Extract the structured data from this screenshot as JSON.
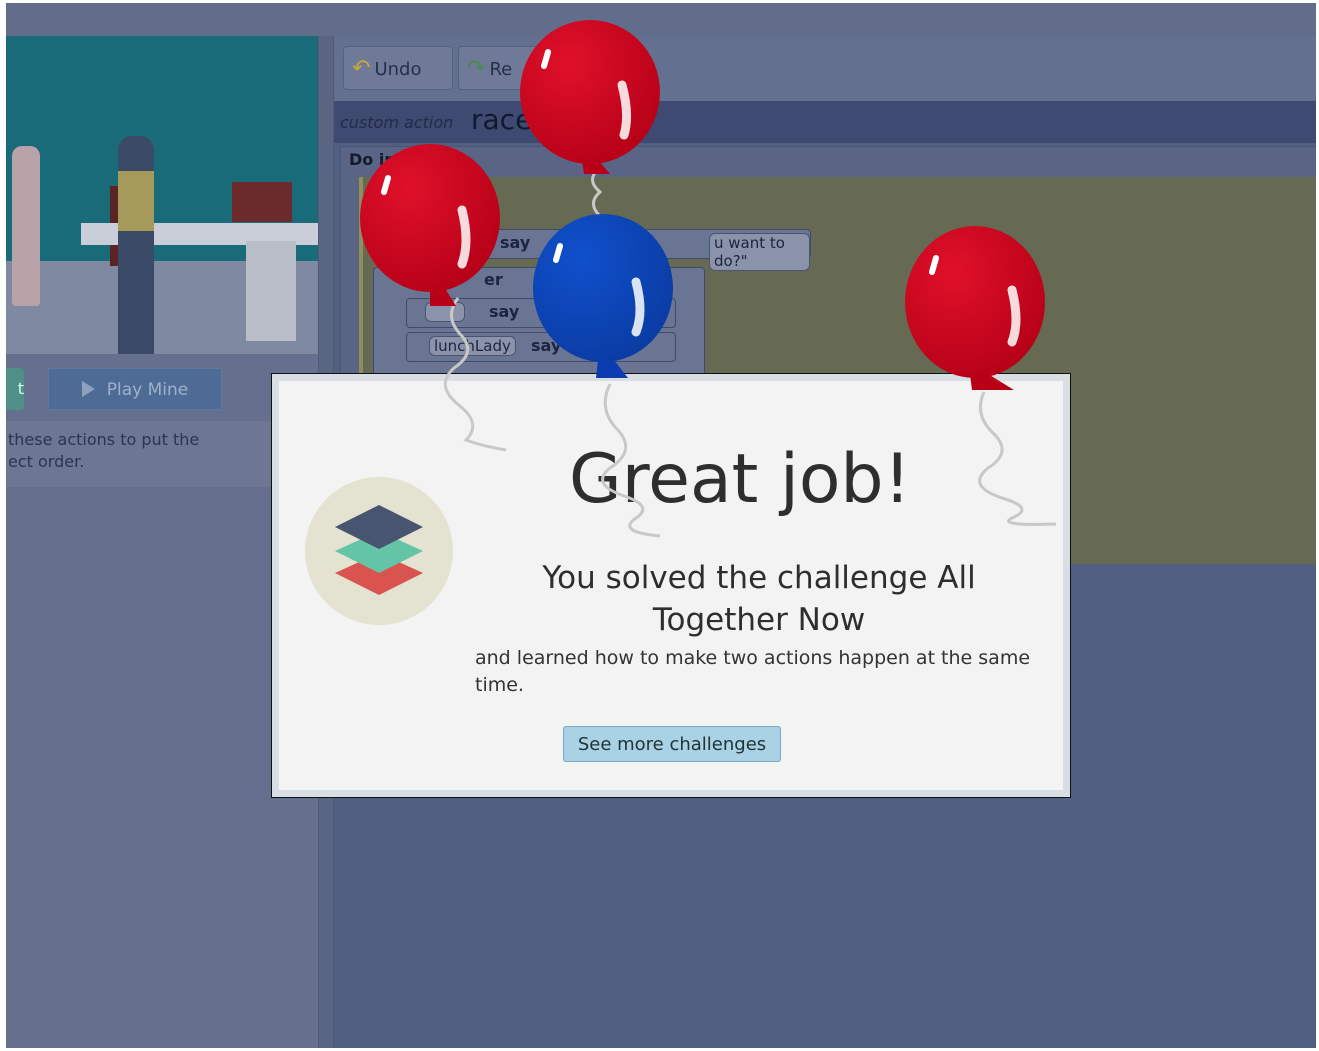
{
  "left_panel": {
    "play_button": "Play Mine",
    "instruction_line1": "these actions to put the",
    "instruction_line2": "ect order."
  },
  "toolbar": {
    "undo": "Undo",
    "redo": "Re"
  },
  "editor": {
    "custom_action_label": "custom action",
    "action_name": "race",
    "do_in_label": "Do in",
    "block_say1_keyword": "say",
    "block_say1_text": "u want to do?\"",
    "block_together_label": "er",
    "block_say2_keyword": "say",
    "block_say3_actor": "lunchLady",
    "block_say3_keyword": "say"
  },
  "modal": {
    "title": "Great job!",
    "subtitle": "You solved the challenge All Together Now",
    "description": "and learned how to make two actions happen at the same time.",
    "cta": "See more challenges"
  },
  "colors": {
    "balloon_red": "#c0001a",
    "balloon_blue": "#0a3fb0",
    "logo_top": "#475570",
    "logo_middle": "#63c4a6",
    "logo_bottom": "#d9534f"
  }
}
